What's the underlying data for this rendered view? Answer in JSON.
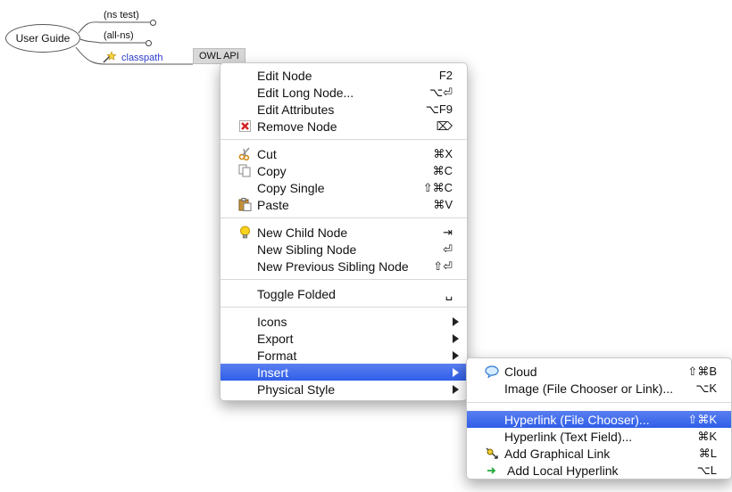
{
  "mindmap": {
    "root": "User Guide",
    "children": [
      "(ns test)",
      "(all-ns)",
      "classpath"
    ],
    "attached_node": "OWL API"
  },
  "context_menu": {
    "groups": [
      [
        {
          "label": "Edit Node",
          "shortcut": "F2",
          "icon": ""
        },
        {
          "label": "Edit Long Node...",
          "shortcut": "⌥⏎",
          "icon": ""
        },
        {
          "label": "Edit Attributes",
          "shortcut": "⌥F9",
          "icon": ""
        },
        {
          "label": "Remove Node",
          "shortcut": "⌦",
          "icon": "red-x-icon"
        }
      ],
      [
        {
          "label": "Cut",
          "shortcut": "⌘X",
          "icon": "scissors-icon"
        },
        {
          "label": "Copy",
          "shortcut": "⌘C",
          "icon": "copy-icon"
        },
        {
          "label": "Copy Single",
          "shortcut": "⇧⌘C",
          "icon": ""
        },
        {
          "label": "Paste",
          "shortcut": "⌘V",
          "icon": "paste-icon"
        }
      ],
      [
        {
          "label": "New Child Node",
          "shortcut": "⇥",
          "icon": "lightbulb-icon"
        },
        {
          "label": "New Sibling Node",
          "shortcut": "⏎",
          "icon": ""
        },
        {
          "label": "New Previous Sibling Node",
          "shortcut": "⇧⏎",
          "icon": ""
        }
      ],
      [
        {
          "label": "Toggle Folded",
          "shortcut": "␣",
          "icon": ""
        }
      ],
      [
        {
          "label": "Icons",
          "submenu": true
        },
        {
          "label": "Export",
          "submenu": true
        },
        {
          "label": "Format",
          "submenu": true
        },
        {
          "label": "Insert",
          "submenu": true,
          "highlighted": true
        },
        {
          "label": "Physical Style",
          "submenu": true
        }
      ]
    ]
  },
  "insert_submenu": {
    "groups": [
      [
        {
          "label": "Cloud",
          "shortcut": "⇧⌘B",
          "icon": "cloud-icon"
        },
        {
          "label": "Image (File Chooser or Link)...",
          "shortcut": "⌥K",
          "icon": ""
        }
      ],
      [
        {
          "label": "Hyperlink (File Chooser)...",
          "shortcut": "⇧⌘K",
          "icon": "",
          "highlighted": true
        },
        {
          "label": "Hyperlink (Text Field)...",
          "shortcut": "⌘K",
          "icon": ""
        },
        {
          "label": "Add Graphical Link",
          "shortcut": "⌘L",
          "icon": "graphical-link-icon"
        },
        {
          "label": "Add Local Hyperlink",
          "shortcut": "⌥L",
          "icon": "green-arrow-icon"
        }
      ]
    ]
  },
  "colors": {
    "highlight": "#3a66ea",
    "link_text": "#2a3ac8"
  }
}
